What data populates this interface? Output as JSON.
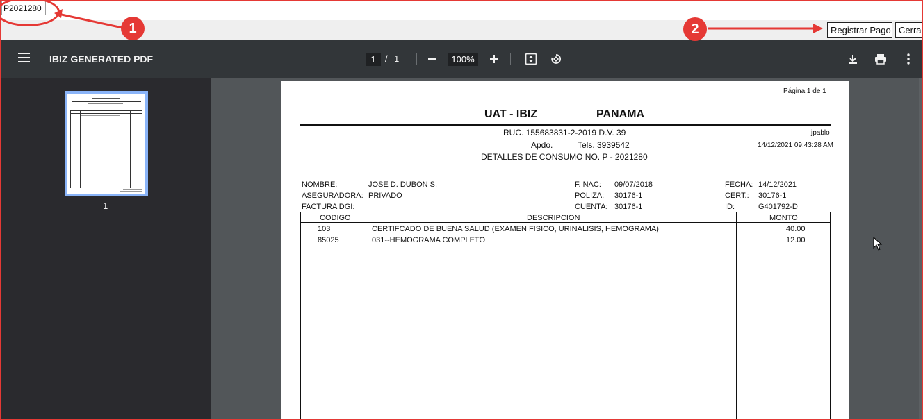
{
  "app": {
    "tab_label": "P2021280",
    "actions": {
      "registrar_label": "Registrar Pago",
      "cerrar_label": "Cerrar"
    }
  },
  "viewer": {
    "title": "IBIZ GENERATED PDF",
    "page_current": "1",
    "page_sep": "/",
    "page_total": "1",
    "zoom": "100%",
    "thumb_number": "1",
    "icons": [
      "menu-icon",
      "zoom-out-icon",
      "zoom-in-icon",
      "fit-page-icon",
      "rotate-icon",
      "download-icon",
      "print-icon",
      "more-vert-icon"
    ]
  },
  "document": {
    "page_label": "Página 1 de 1",
    "company": "UAT - IBIZ",
    "country": "PANAMA",
    "ruc": "RUC. 155683831-2-2019 D.V. 39",
    "apdo": "Apdo.",
    "tels": "Tels. 3939542",
    "detail_title": "DETALLES DE CONSUMO NO. P - 2021280",
    "user": "jpablo",
    "timestamp": "14/12/2021 09:43:28 AM",
    "fields": {
      "nombre_label": "NOMBRE:",
      "nombre": "JOSE D. DUBON S.",
      "aseguradora_label": "ASEGURADORA:",
      "aseguradora": "PRIVADO",
      "factura_label": "FACTURA DGI:",
      "fnac_label": "F. NAC:",
      "fnac": "09/07/2018",
      "poliza_label": "POLIZA:",
      "poliza": "30176-1",
      "cuenta_label": "CUENTA:",
      "cuenta": "30176-1",
      "fecha_label": "FECHA:",
      "fecha": "14/12/2021",
      "cert_label": "CERT.:",
      "cert": "30176-1",
      "id_label": "ID:",
      "id": "G401792-D"
    },
    "table": {
      "headers": {
        "codigo": "CODIGO",
        "descripcion": "DESCRIPCION",
        "monto": "MONTO"
      },
      "rows": [
        {
          "codigo": "103",
          "descripcion": "CERTIFCADO DE BUENA SALUD (EXAMEN FISICO, URINALISIS, HEMOGRAMA)",
          "monto": "40.00"
        },
        {
          "codigo": "85025",
          "descripcion": "031--HEMOGRAMA COMPLETO",
          "monto": "12.00"
        }
      ]
    }
  },
  "annotations": {
    "badge1": "1",
    "badge2": "2",
    "color": "#e53935"
  }
}
